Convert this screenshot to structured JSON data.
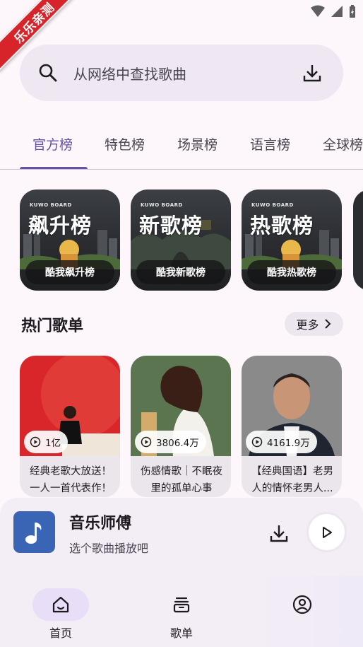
{
  "watermark": "乐乐亲测",
  "search": {
    "placeholder": "从网络中查找歌曲"
  },
  "tabs": [
    {
      "label": "官方榜",
      "active": true
    },
    {
      "label": "特色榜",
      "active": false
    },
    {
      "label": "场景榜",
      "active": false
    },
    {
      "label": "语言榜",
      "active": false
    },
    {
      "label": "全球榜",
      "active": false
    }
  ],
  "charts": [
    {
      "brand": "KUWO BOARD",
      "title": "飙升榜",
      "caption": "酷我飙升榜"
    },
    {
      "brand": "KUWO BOARD",
      "title": "新歌榜",
      "caption": "酷我新歌榜"
    },
    {
      "brand": "KUWO BOARD",
      "title": "热歌榜",
      "caption": "酷我热歌榜"
    }
  ],
  "hot_playlists": {
    "title": "热门歌单",
    "more_label": "更多",
    "items": [
      {
        "count": "1亿",
        "name": "经典老歌大放送！一人一首代表作！"
      },
      {
        "count": "3806.4万",
        "name": "伤感情歌｜不眠夜里的孤单心事"
      },
      {
        "count": "4161.9万",
        "name": "【经典国语】老男人的情怀老男人..."
      }
    ]
  },
  "player": {
    "title": "音乐师傅",
    "subtitle": "选个歌曲播放吧"
  },
  "nav": [
    {
      "label": "首页",
      "icon": "home-icon",
      "active": true
    },
    {
      "label": "歌单",
      "icon": "playlist-icon",
      "active": false
    },
    {
      "label": "",
      "icon": "profile-icon",
      "active": false
    }
  ],
  "colors": {
    "accent": "#6750a4",
    "background": "#fdf7fc",
    "surface": "#efe7f1",
    "watermark": "#d7232a"
  }
}
